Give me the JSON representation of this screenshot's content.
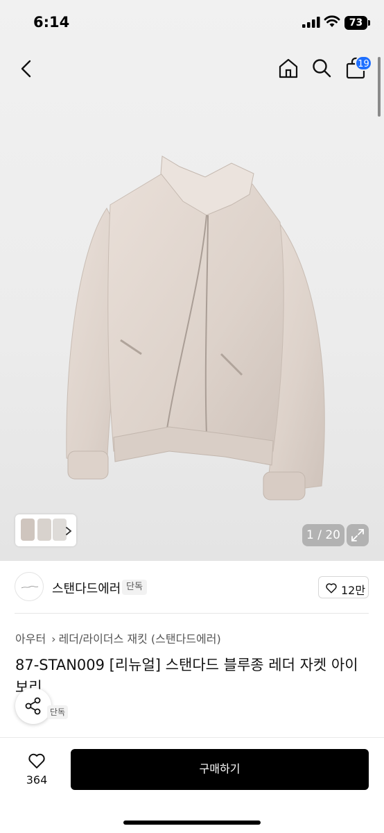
{
  "status": {
    "time": "6:14",
    "battery": "73"
  },
  "header": {
    "cart_count": "19"
  },
  "gallery": {
    "counter": "1 / 20"
  },
  "brand": {
    "name": "스탠다드에러",
    "tag": "단독",
    "likes": "12만"
  },
  "breadcrumb": {
    "category": "아우터",
    "subcategory": "레더/라이더스 재킷 (스탠다드에러)"
  },
  "product": {
    "title": "87-STAN009 [리뉴얼] 스탠다드 블루종 레더 자켓 아이보리",
    "tag": "단독"
  },
  "bottom": {
    "wish_count": "364",
    "buy_label": "구매하기"
  },
  "colors": {
    "accent": "#1e6fff",
    "buy_button": "#000000"
  }
}
